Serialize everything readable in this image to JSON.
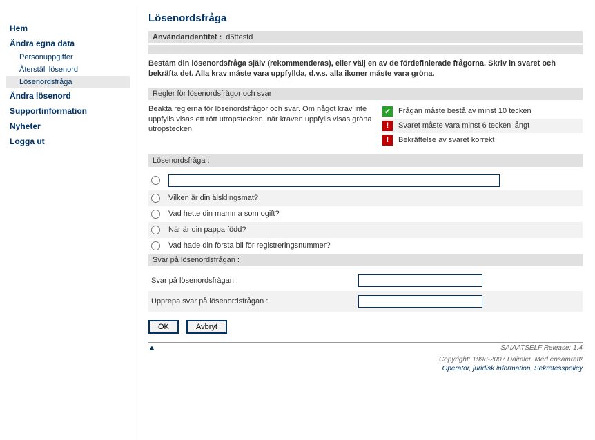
{
  "nav": {
    "home": "Hem",
    "edit_data": "Ändra egna data",
    "personal": "Personuppgifter",
    "reset_pw": "Återställ lösenord",
    "pw_question": "Lösenordsfråga",
    "change_pw": "Ändra lösenord",
    "support": "Supportinformation",
    "news": "Nyheter",
    "logout": "Logga ut"
  },
  "page": {
    "title": "Lösenordsfråga",
    "ident_label": "Användaridentitet :",
    "ident_value": "d5ttestd",
    "instructions": "Bestäm din lösenordsfråga själv (rekommenderas), eller välj en av de fördefinierade frågorna. Skriv in svaret och bekräfta det. Alla krav måste vara uppfyllda, d.v.s. alla ikoner måste vara gröna."
  },
  "rules": {
    "header": "Regler för lösenordsfrågor och svar",
    "text": "Beakta reglerna för lösenordsfrågor och svar. Om något krav inte uppfylls visas ett rött utropstecken, när kraven uppfylls visas gröna utropstecken.",
    "items": [
      {
        "status": "ok",
        "text": "Frågan måste bestå av minst 10 tecken"
      },
      {
        "status": "err",
        "text": "Svaret måste vara minst 6 tecken långt"
      },
      {
        "status": "err",
        "text": "Bekräftelse av svaret korrekt"
      }
    ]
  },
  "question": {
    "header": "Lösenordsfråga :",
    "custom_value": "",
    "options": [
      "Vilken är din älsklingsmat?",
      "Vad hette din mamma som ogift?",
      "När är din pappa född?",
      "Vad hade din första bil för registreringsnummer?"
    ]
  },
  "answer": {
    "header": "Svar på lösenordsfrågan :",
    "label": "Svar på lösenordsfrågan :",
    "repeat_label": "Upprepa svar på lösenordsfrågan :",
    "value": "",
    "repeat_value": ""
  },
  "buttons": {
    "ok": "OK",
    "cancel": "Avbryt"
  },
  "footer": {
    "release": "SAIAATSELF Release: 1.4",
    "copyright": "Copyright: 1998-2007 Daimler. Med ensamrätt!",
    "links": "Operatör, juridisk information, Sekretesspolicy"
  }
}
